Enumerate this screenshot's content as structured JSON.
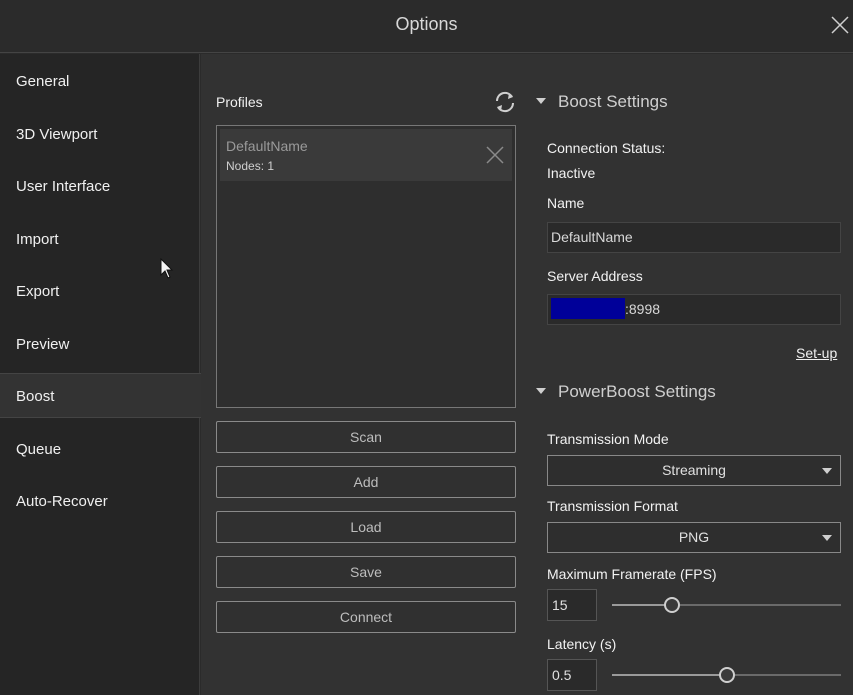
{
  "window": {
    "title": "Options"
  },
  "sidebar": {
    "items": [
      {
        "label": "General"
      },
      {
        "label": "3D Viewport"
      },
      {
        "label": "User Interface"
      },
      {
        "label": "Import"
      },
      {
        "label": "Export"
      },
      {
        "label": "Preview"
      },
      {
        "label": "Boost"
      },
      {
        "label": "Queue"
      },
      {
        "label": "Auto-Recover"
      }
    ],
    "active": "Boost"
  },
  "profiles": {
    "label": "Profiles",
    "items": [
      {
        "name": "DefaultName",
        "nodes": "Nodes: 1"
      }
    ],
    "buttons": {
      "scan": "Scan",
      "add": "Add",
      "load": "Load",
      "save": "Save",
      "connect": "Connect"
    }
  },
  "boost": {
    "heading": "Boost Settings",
    "connection_status_label": "Connection Status:",
    "connection_status_value": "Inactive",
    "name_label": "Name",
    "name_value": "DefaultName",
    "server_label": "Server Address",
    "server_port": ":8998",
    "setup_link": "Set-up"
  },
  "powerboost": {
    "heading": "PowerBoost Settings",
    "transmission_mode_label": "Transmission Mode",
    "transmission_mode_value": "Streaming",
    "transmission_format_label": "Transmission Format",
    "transmission_format_value": "PNG",
    "max_framerate_label": "Maximum Framerate (FPS)",
    "max_framerate_value": "15",
    "max_framerate_slider_fraction": 0.26,
    "latency_label": "Latency (s)",
    "latency_value": "0.5",
    "latency_slider_fraction": 0.5
  }
}
